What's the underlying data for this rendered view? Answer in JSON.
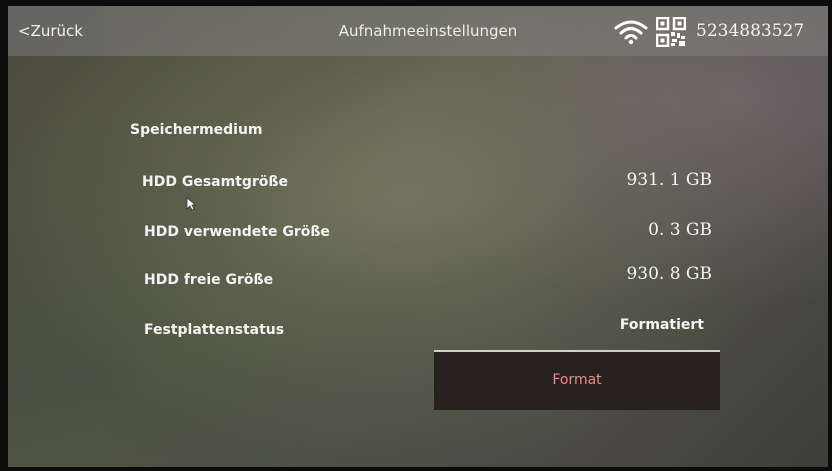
{
  "header": {
    "back_label": "<Zurück",
    "title": "Aufnahmeeinstellungen",
    "device_id": "5234883527",
    "icons": [
      "wifi-icon",
      "qr-code-icon"
    ]
  },
  "storage": {
    "section_label": "Speichermedium",
    "rows": [
      {
        "label": "HDD Gesamtgröße",
        "value": "931. 1  GB"
      },
      {
        "label": "HDD verwendete Größe",
        "value": "0. 3  GB"
      },
      {
        "label": "HDD freie Größe",
        "value": "930. 8  GB"
      },
      {
        "label": "Festplattenstatus",
        "value": "Formatiert"
      }
    ]
  },
  "actions": {
    "format_label": "Format"
  },
  "colors": {
    "format_text": "#f08a8a",
    "format_bg": "#26201f"
  }
}
